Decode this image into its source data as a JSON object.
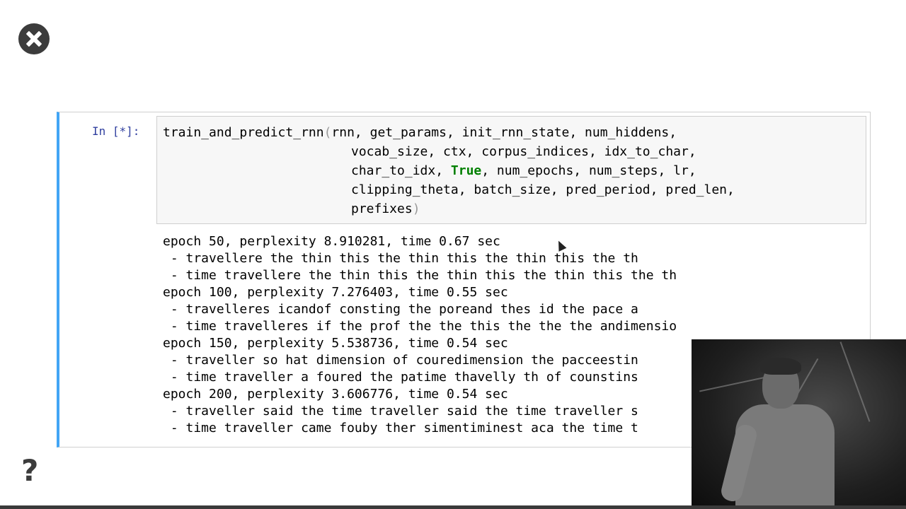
{
  "controls": {
    "close_icon": "close-icon",
    "help_label": "?"
  },
  "cell": {
    "prompt": "In [*]:",
    "code": {
      "line1": "train_and_predict_rnn",
      "line1_paren": "(",
      "line1_rest": "rnn, get_params, init_rnn_state, num_hiddens,",
      "line2": "vocab_size, ctx, corpus_indices, idx_to_char,",
      "line3_pre": "char_to_idx, ",
      "line3_kw": "True",
      "line3_post": ", num_epochs, num_steps, lr,",
      "line4": "clipping_theta, batch_size, pred_period, pred_len,",
      "line5": "prefixes",
      "line5_paren": ")"
    },
    "output": [
      "epoch 50, perplexity 8.910281, time 0.67 sec",
      " - travellere the thin this the thin this the thin this the th",
      " - time travellere the thin this the thin this the thin this the th",
      "epoch 100, perplexity 7.276403, time 0.55 sec",
      " - travelleres icandof consting the poreand thes id the pace a",
      " - time travelleres if the prof the the this the the the andimensio",
      "epoch 150, perplexity 5.538736, time 0.54 sec",
      " - traveller so hat dimension of couredimension the pacceestin",
      " - time traveller a foured the patime thavelly th of counstins",
      "epoch 200, perplexity 3.606776, time 0.54 sec",
      " - traveller said the time traveller said the time traveller s",
      " - time traveller came fouby ther simentiminest aca the time t"
    ]
  },
  "colors": {
    "cell_accent": "#42a5f5",
    "prompt": "#303f9f",
    "keyword": "#008000"
  }
}
